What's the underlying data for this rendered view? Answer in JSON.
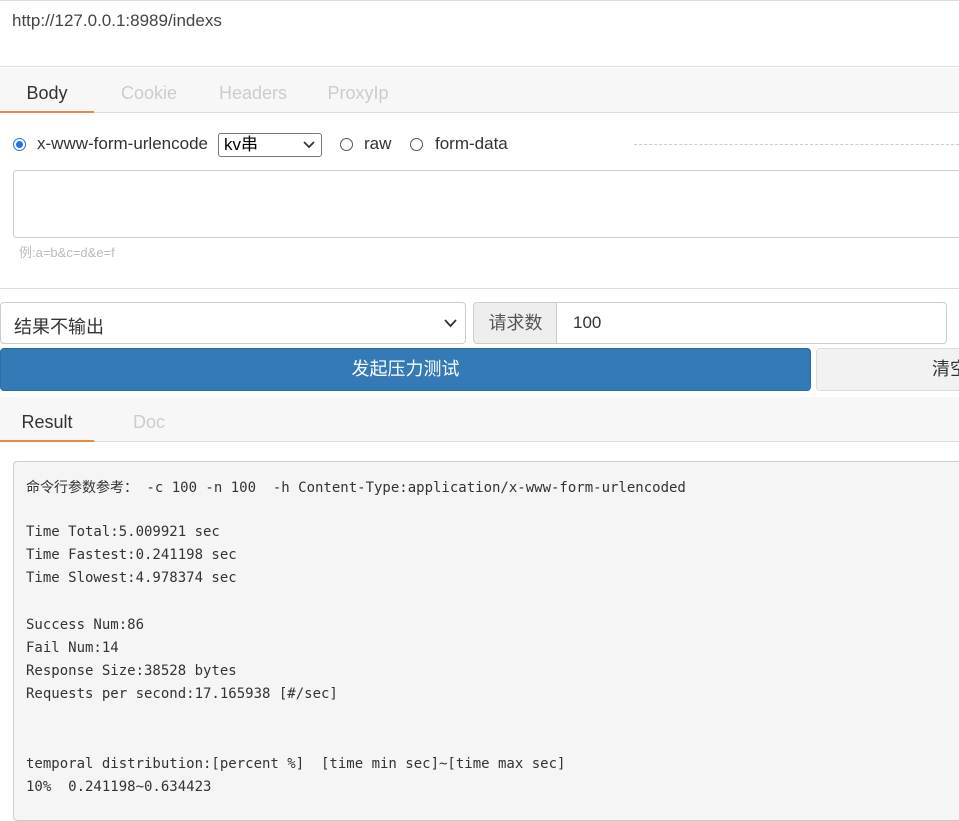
{
  "url": "http://127.0.0.1:8989/indexs",
  "request_tabs": [
    "Body",
    "Cookie",
    "Headers",
    "ProxyIp"
  ],
  "body_type": {
    "options": [
      {
        "label": "x-www-form-urlencode",
        "checked": true
      },
      {
        "label": "raw",
        "checked": false
      },
      {
        "label": "form-data",
        "checked": false
      }
    ],
    "format_select": "kv串"
  },
  "body_input": {
    "value": "",
    "hint": "例:a=b&c=d&e=f"
  },
  "output_select": "结果不输出",
  "request_count": {
    "label": "请求数",
    "value": "100"
  },
  "buttons": {
    "start": "发起压力测试",
    "clear": "清空"
  },
  "result_tabs": [
    "Result",
    "Doc"
  ],
  "result_lines": [
    "命令行参数参考： -c 100 -n 100  -h Content-Type:application/x-www-form-urlencoded",
    "",
    "Time Total:5.009921 sec",
    "Time Fastest:0.241198 sec",
    "Time Slowest:4.978374 sec",
    "",
    "Success Num:86",
    "Fail Num:14",
    "Response Size:38528 bytes",
    "Requests per second:17.165938 [#/sec]",
    "",
    "",
    "temporal distribution:[percent %]  [time min sec]~[time max sec]",
    "10%  0.241198~0.634423"
  ],
  "colors": {
    "accent_tab": "#f0854a",
    "primary_button": "#337ab7",
    "radio_checked": "#1e73e8"
  }
}
